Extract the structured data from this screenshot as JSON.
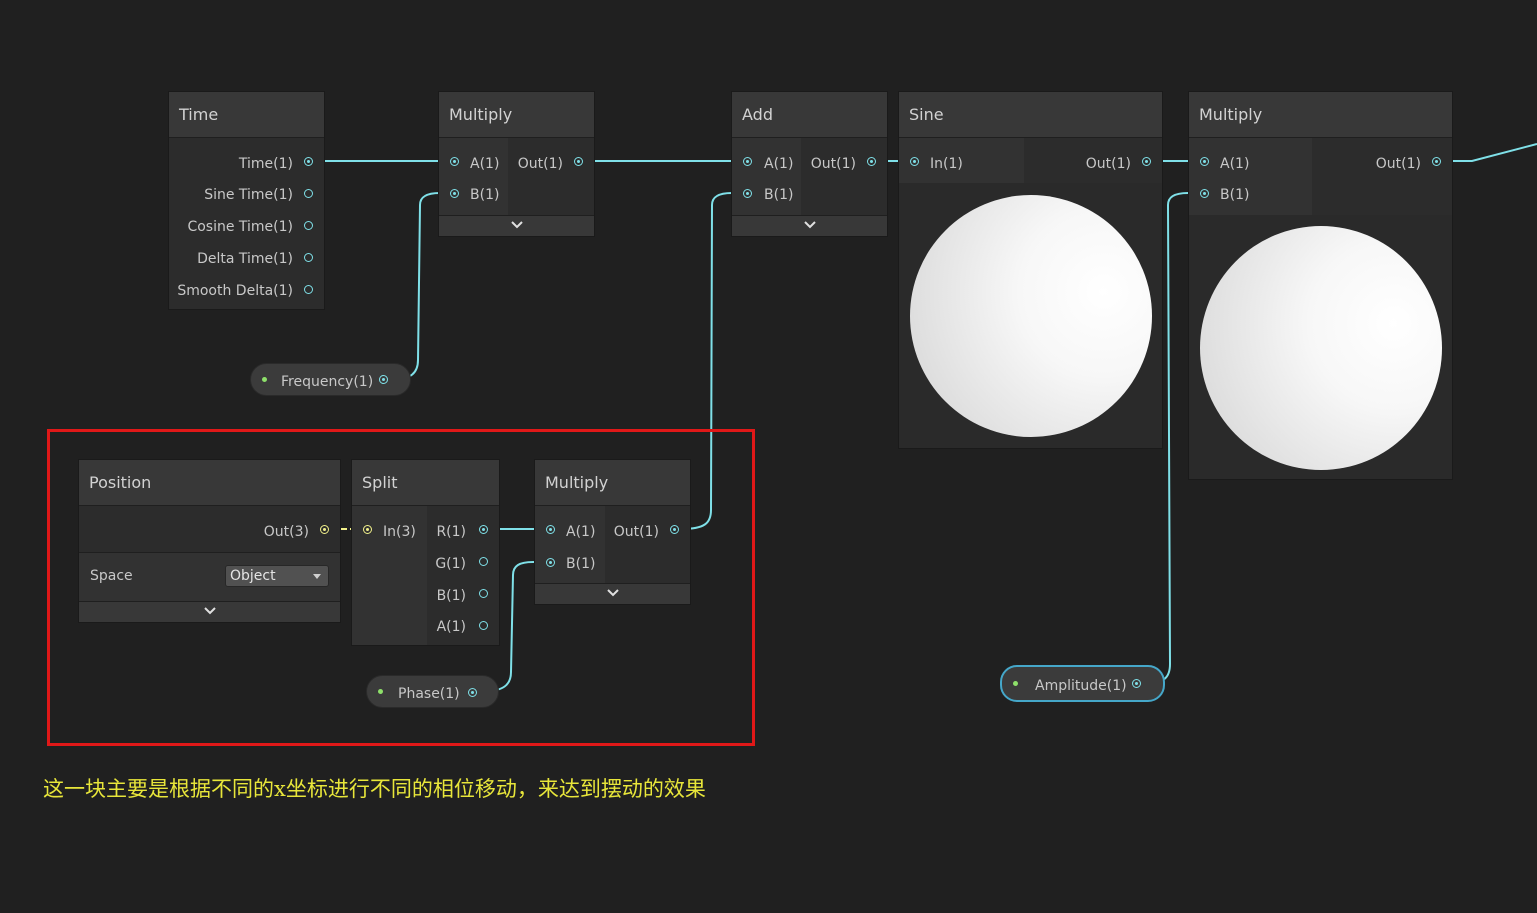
{
  "colors": {
    "background": "#202020",
    "wire": "#7fe0e8",
    "wire_vector": "#f1f08a",
    "highlight_frame": "#e01818",
    "annotation": "#e8e63a",
    "property_dot": "#8ee06a"
  },
  "time_node": {
    "title": "Time",
    "outputs": [
      "Time(1)",
      "Sine Time(1)",
      "Cosine Time(1)",
      "Delta Time(1)",
      "Smooth Delta(1)"
    ]
  },
  "multiply1": {
    "title": "Multiply",
    "in_a": "A(1)",
    "in_b": "B(1)",
    "out": "Out(1)"
  },
  "add_node": {
    "title": "Add",
    "in_a": "A(1)",
    "in_b": "B(1)",
    "out": "Out(1)"
  },
  "sine_node": {
    "title": "Sine",
    "in": "In(1)",
    "out": "Out(1)"
  },
  "multiply2": {
    "title": "Multiply",
    "in_a": "A(1)",
    "in_b": "B(1)",
    "out": "Out(1)"
  },
  "frequency": {
    "label": "Frequency(1)"
  },
  "position_node": {
    "title": "Position",
    "out": "Out(3)",
    "space_label": "Space",
    "space_value": "Object"
  },
  "split_node": {
    "title": "Split",
    "in": "In(3)",
    "outputs": [
      "R(1)",
      "G(1)",
      "B(1)",
      "A(1)"
    ]
  },
  "multiply3": {
    "title": "Multiply",
    "in_a": "A(1)",
    "in_b": "B(1)",
    "out": "Out(1)"
  },
  "phase": {
    "label": "Phase(1)"
  },
  "amplitude": {
    "label": "Amplitude(1)"
  },
  "annotation": {
    "text": "这一块主要是根据不同的x坐标进行不同的相位移动，来达到摆动的效果"
  }
}
